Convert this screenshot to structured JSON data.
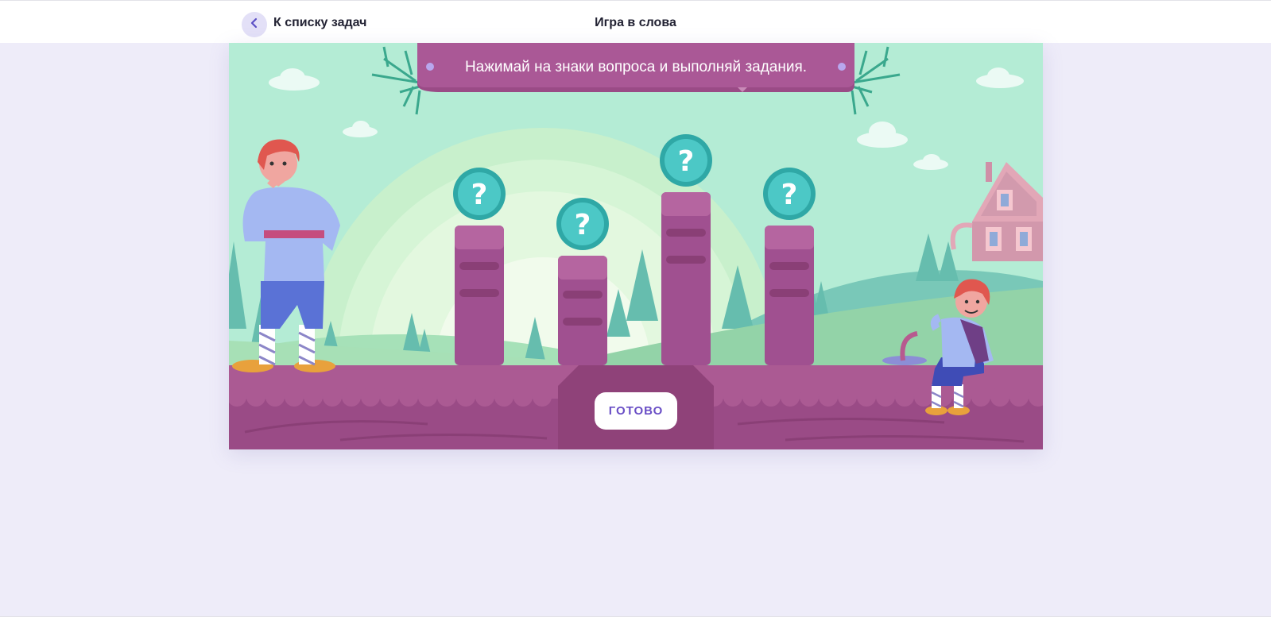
{
  "header": {
    "back_label": "К списку задач",
    "title": "Игра в слова"
  },
  "game": {
    "instruction": "Нажимай на знаки вопроса и выполняй задания.",
    "done_label": "ГОТОВО",
    "question_mark": "?",
    "question_count": 4
  },
  "icons": {
    "back": "chevron-left-icon",
    "question": "question-mark-icon"
  },
  "colors": {
    "accent": "#6a4fc6",
    "banner": "#a9568f",
    "sky": "#b4ecd5",
    "ground": "#ab5a93",
    "question_badge": "#4cc8c6"
  }
}
